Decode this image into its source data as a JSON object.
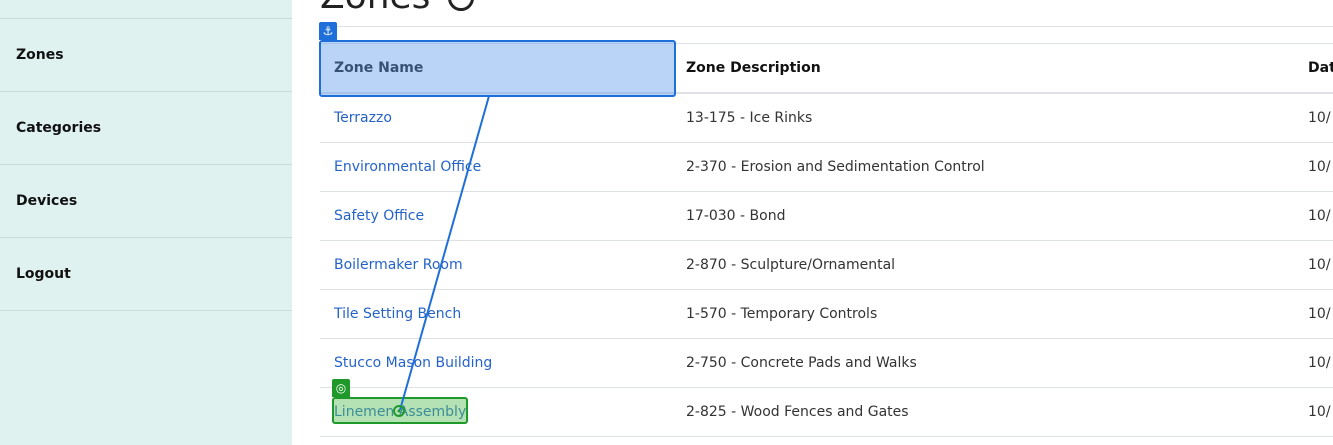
{
  "sidebar": {
    "items": [
      {
        "label": "Zones"
      },
      {
        "label": "Categories"
      },
      {
        "label": "Devices"
      },
      {
        "label": "Logout"
      }
    ]
  },
  "page": {
    "title_fragment": "Zones"
  },
  "table": {
    "headers": [
      "Zone Name",
      "Zone Description",
      "Dat"
    ],
    "rows": [
      {
        "name": "Terrazzo",
        "description": "13-175 - Ice Rinks",
        "date": "10/"
      },
      {
        "name": "Environmental Office",
        "description": "2-370 - Erosion and Sedimentation Control",
        "date": "10/"
      },
      {
        "name": "Safety Office",
        "description": "17-030 - Bond",
        "date": "10/"
      },
      {
        "name": "Boilermaker Room",
        "description": "2-870 - Sculpture/Ornamental",
        "date": "10/"
      },
      {
        "name": "Tile Setting Bench",
        "description": "1-570 - Temporary Controls",
        "date": "10/"
      },
      {
        "name": "Stucco Mason Building",
        "description": "2-750 - Concrete Pads and Walks",
        "date": "10/"
      },
      {
        "name": "Linemen Assembly",
        "description": "2-825 - Wood Fences and Gates",
        "date": "10/"
      }
    ]
  },
  "overlay": {
    "anchor_icon": "anchor-icon",
    "target_icon": "target-icon",
    "anchor_color": "#1e6fd9",
    "target_color": "#1f9a2a"
  }
}
